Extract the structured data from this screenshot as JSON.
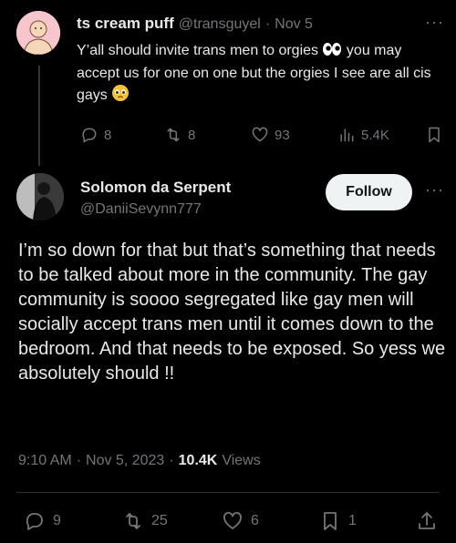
{
  "parent_tweet": {
    "display_name": "ts cream puff",
    "handle": "@transguyel",
    "separator": "·",
    "date": "Nov 5",
    "text_part1": "Y’all should invite trans men to orgies ",
    "emoji_1": "eyes-emoji",
    "text_part2": " you may accept us for one on one but the orgies I see are all cis gays ",
    "emoji_2": "pleading-face-emoji",
    "replies": "8",
    "retweets": "8",
    "likes": "93",
    "views": "5.4K"
  },
  "main_tweet": {
    "display_name": "Solomon da Serpent",
    "handle": "@DaniiSevynn777",
    "follow_label": "Follow",
    "more_label": "···",
    "text": "I’m so down for that but that’s something that needs to be talked about more in the community. The gay community is soooo segregated like gay men will socially accept trans men until it comes down to the bedroom. And that needs to be exposed. So yess we absolutely should !!",
    "time": "9:10 AM",
    "date": "Nov 5, 2023",
    "views_count": "10.4K",
    "views_label": "Views",
    "replies": "9",
    "retweets": "25",
    "likes": "6",
    "bookmarks": "1"
  },
  "colors": {
    "background": "#000000",
    "text": "#e7e9ea",
    "muted": "#71767b",
    "follow_bg": "#eff3f4"
  }
}
